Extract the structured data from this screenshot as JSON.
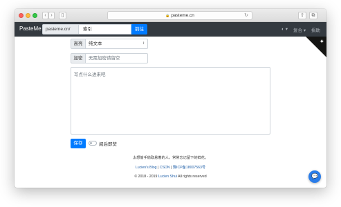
{
  "browser": {
    "address": "pasteme.cn",
    "buttons": {
      "back": "‹",
      "forward": "›",
      "sidebar": "▯",
      "reload": "↻",
      "share": "⇧",
      "tabs": "⧉"
    },
    "colors": {
      "red": "#fc605c",
      "yellow": "#fdbc40",
      "green": "#34c84a"
    }
  },
  "navbar": {
    "brand": "PasteMe",
    "url_prefix": "pasteme.cn/",
    "url_placeholder": "索引",
    "go_label": "前往",
    "lang_icon": "globe-icon",
    "lang_glyph": "◐",
    "lang_caret": "▾",
    "paste_menu": "复合",
    "paste_caret": "▾",
    "about": "捐助",
    "corner_icon": "github-octocat-icon",
    "corner_glyph": "✦"
  },
  "form": {
    "highlight_label": "高亮",
    "highlight_value": "纯文本",
    "highlight_caret": "↕",
    "password_label": "加密",
    "password_placeholder": "无需加密请留空",
    "content_placeholder": "写点什么进来吧",
    "save_label": "保存",
    "burn_after_read_label": "阅后即焚",
    "burn_after_read_on": false
  },
  "footer": {
    "slogan": "太想偷手偷取悬着的人，常常忘记留下的鲜花。",
    "link_blog": "Lucien's Blog",
    "sep1": "|",
    "link_csdn": "CSDN",
    "sep2": "|",
    "link_icp": "豫ICP备18007563号",
    "copyright_prefix": "© 2018 - 2019",
    "copyright_author": "Lucien Shui",
    "copyright_suffix": "All rights reserved"
  },
  "chat": {
    "icon": "chat-bubble-icon",
    "glyph": "💬"
  },
  "accent": "#007bff"
}
